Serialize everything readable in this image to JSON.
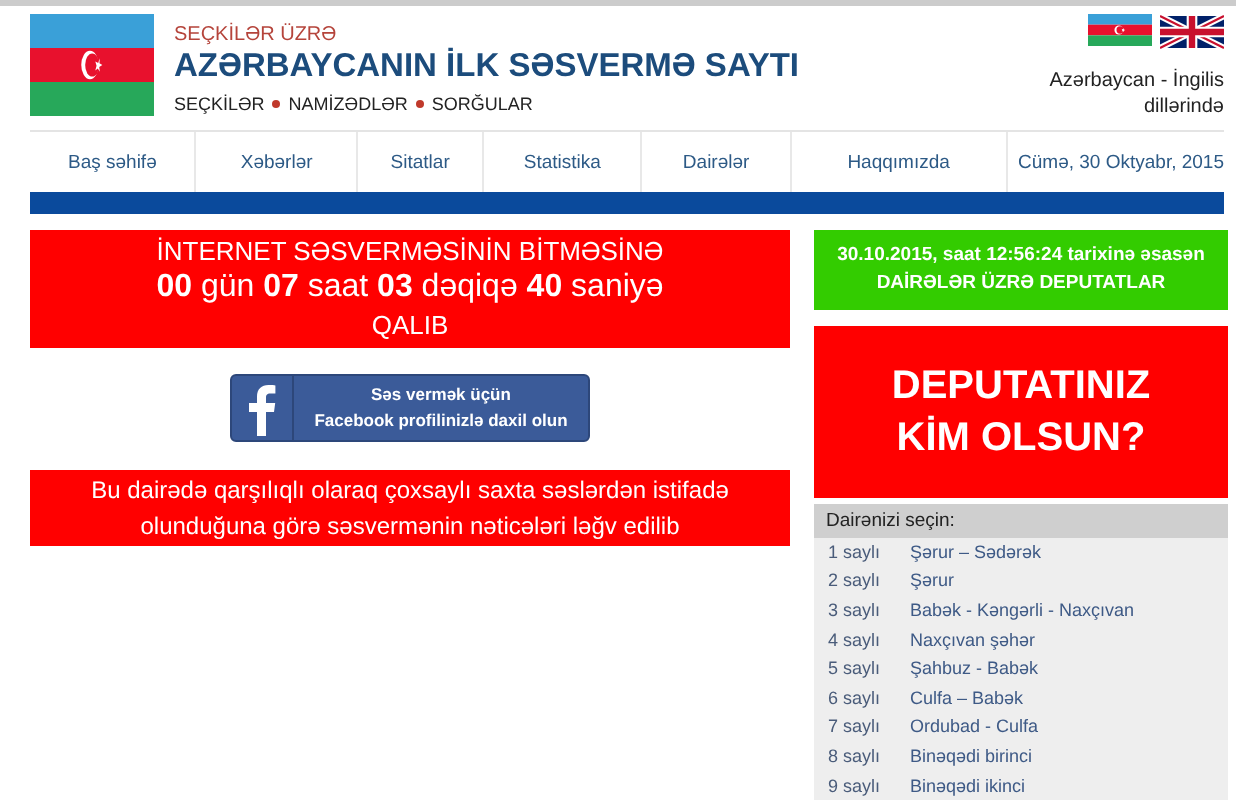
{
  "header": {
    "kicker": "SEÇKİLƏR ÜZRƏ",
    "title": "AZƏRBAYCANIN İLK SƏSVERMƏ SAYTI",
    "links": [
      "SEÇKİLƏR",
      "NAMİZƏDLƏR",
      "SORĞULAR"
    ],
    "language_note": "Azərbaycan - İngilis dillərində"
  },
  "nav": {
    "items": [
      "Baş səhifə",
      "Xəbərlər",
      "Sitatlar",
      "Statistika",
      "Dairələr",
      "Haqqımızda"
    ],
    "date": "Cümə, 30 Oktyabr, 2015"
  },
  "countdown": {
    "heading": "İNTERNET SƏSVERMƏSİNİN BİTMƏSİNƏ",
    "parts": [
      {
        "value": "00",
        "unit": "gün"
      },
      {
        "value": "07",
        "unit": "saat"
      },
      {
        "value": "03",
        "unit": "dəqiqə"
      },
      {
        "value": "40",
        "unit": "saniyə"
      }
    ],
    "footer": "QALIB"
  },
  "facebook_button": {
    "line1": "Səs vermək üçün",
    "line2": "Facebook profilinizlə daxil olun"
  },
  "notice": "Bu dairədə qarşılıqlı olaraq çoxsaylı saxta səslərdən istifadə olunduğuna görə səsvermənin nəticələri ləğv edilib",
  "results_banner": {
    "line1": "30.10.2015, saat 12:56:24 tarixinə əsasən",
    "line2": "DAİRƏLƏR ÜZRƏ DEPUTATLAR"
  },
  "question_banner": {
    "line1": "DEPUTATINIZ",
    "line2": "KİM OLSUN?"
  },
  "district_list": {
    "heading": "Dairənizi seçin:",
    "rows": [
      {
        "number": "1 saylı",
        "name": "Şərur – Sədərək"
      },
      {
        "number": "2 saylı",
        "name": "Şərur"
      },
      {
        "number": "3 saylı",
        "name": "Babək - Kəngərli - Naxçıvan"
      },
      {
        "number": "4 saylı",
        "name": "Naxçıvan şəhər"
      },
      {
        "number": "5 saylı",
        "name": "Şahbuz - Babək"
      },
      {
        "number": "6 saylı",
        "name": "Culfa – Babək"
      },
      {
        "number": "7 saylı",
        "name": "Ordubad - Culfa"
      },
      {
        "number": "8 saylı",
        "name": "Binəqədi birinci"
      },
      {
        "number": "9 saylı",
        "name": "Binəqədi ikinci"
      }
    ]
  }
}
